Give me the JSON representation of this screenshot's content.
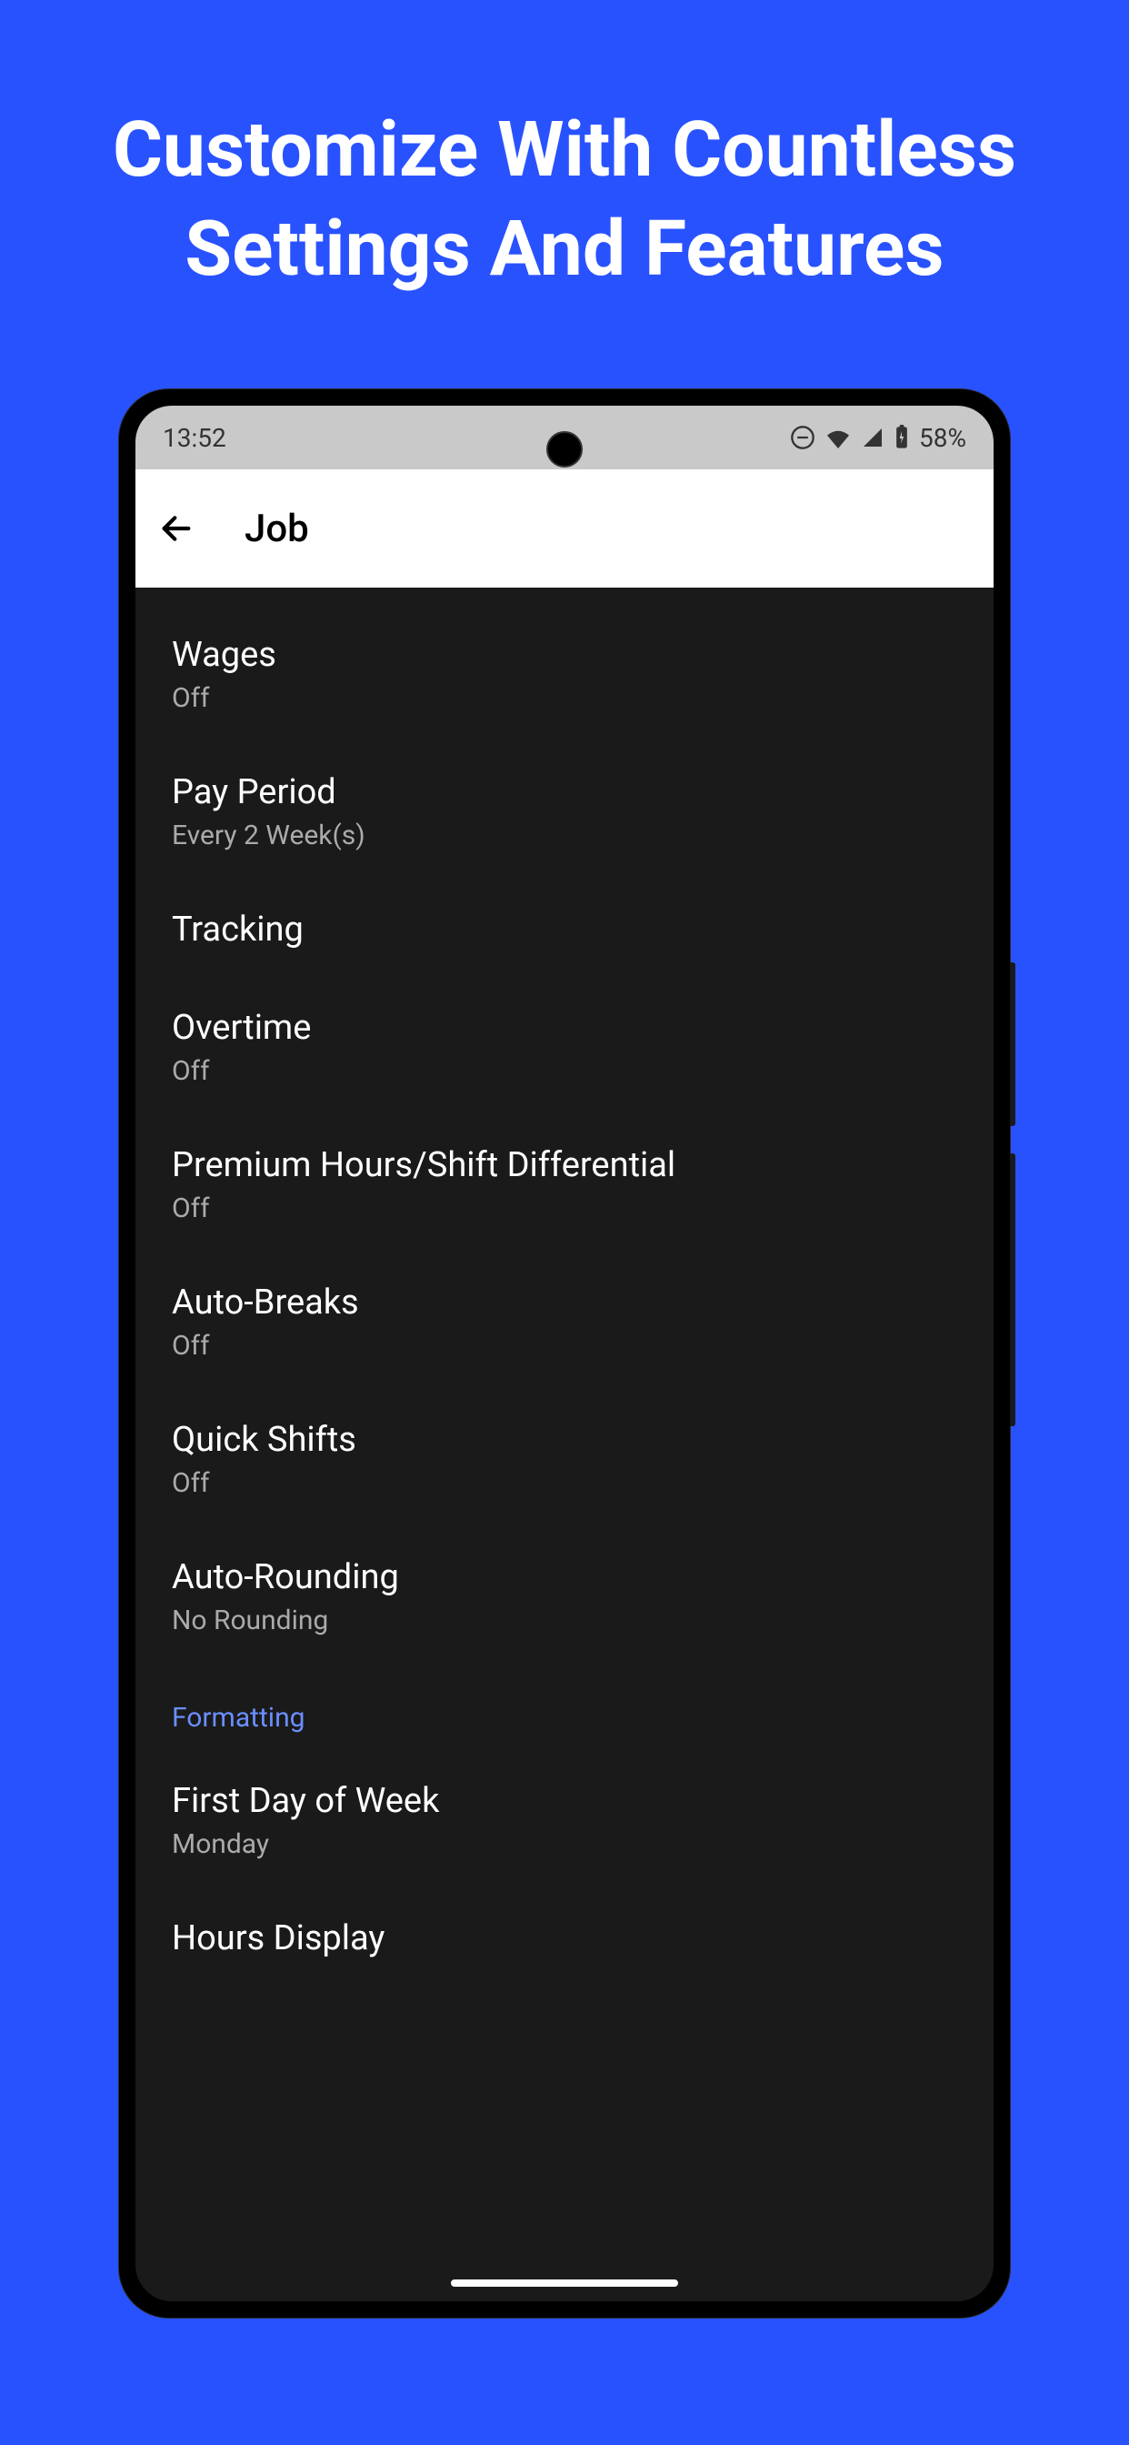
{
  "promo": {
    "heading": "Customize With Countless Settings And Features"
  },
  "statusBar": {
    "time": "13:52",
    "battery": "58%"
  },
  "appBar": {
    "title": "Job"
  },
  "settings": [
    {
      "title": "Wages",
      "subtitle": "Off"
    },
    {
      "title": "Pay Period",
      "subtitle": "Every 2 Week(s)"
    },
    {
      "title": "Tracking",
      "subtitle": null
    },
    {
      "title": "Overtime",
      "subtitle": "Off"
    },
    {
      "title": "Premium Hours/Shift Differential",
      "subtitle": "Off"
    },
    {
      "title": "Auto-Breaks",
      "subtitle": "Off"
    },
    {
      "title": "Quick Shifts",
      "subtitle": "Off"
    },
    {
      "title": "Auto-Rounding",
      "subtitle": "No Rounding"
    }
  ],
  "sectionHeader": "Formatting",
  "formattingSettings": [
    {
      "title": "First Day of Week",
      "subtitle": "Monday"
    },
    {
      "title": "Hours Display",
      "subtitle": null
    }
  ]
}
